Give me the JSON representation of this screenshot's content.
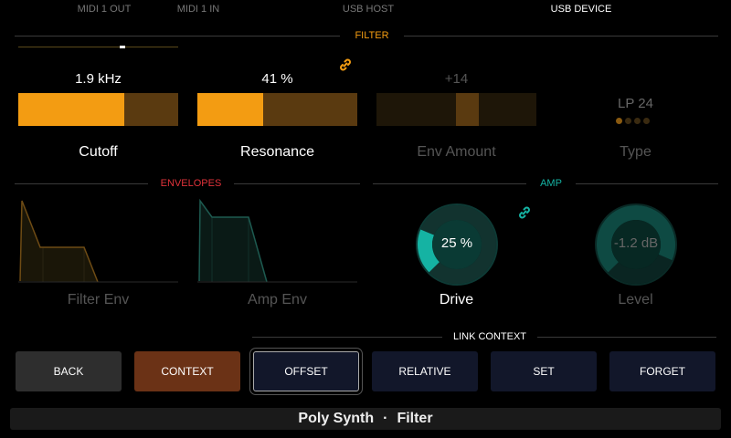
{
  "top_tabs": [
    {
      "label": "MIDI 1 OUT"
    },
    {
      "label": "MIDI 1 IN"
    },
    {
      "label": "USB HOST"
    },
    {
      "label": "USB DEVICE",
      "active": true
    }
  ],
  "filter": {
    "title": "FILTER",
    "cutoff": {
      "value": "1.9 kHz",
      "label": "Cutoff",
      "fraction": 0.66
    },
    "resonance": {
      "value": "41 %",
      "label": "Resonance",
      "fraction": 0.41
    },
    "env_amount": {
      "value": "+14",
      "label": "Env Amount",
      "fraction": 0.64
    },
    "type": {
      "value": "LP 24",
      "label": "Type"
    }
  },
  "envelopes": {
    "title": "ENVELOPES",
    "filter_env": {
      "label": "Filter Env"
    },
    "amp_env": {
      "label": "Amp Env"
    }
  },
  "amp": {
    "title": "AMP",
    "drive": {
      "value": "25 %",
      "label": "Drive",
      "fraction": 0.25
    },
    "level": {
      "value": "-1.2 dB",
      "label": "Level",
      "fraction": 0.92
    }
  },
  "link_context": {
    "title": "LINK CONTEXT",
    "buttons": [
      "BACK",
      "CONTEXT",
      "OFFSET",
      "RELATIVE",
      "SET",
      "FORGET"
    ]
  },
  "footer": {
    "device": "Poly Synth",
    "separator": "·",
    "page": "Filter"
  },
  "colors": {
    "filter_accent": "#f39c12",
    "envelopes_accent": "#e0323a",
    "amp_accent": "#15b3a3",
    "context_button": "#6b3216",
    "button_dark": "#12172a",
    "button_gray": "#2e2e2e"
  }
}
